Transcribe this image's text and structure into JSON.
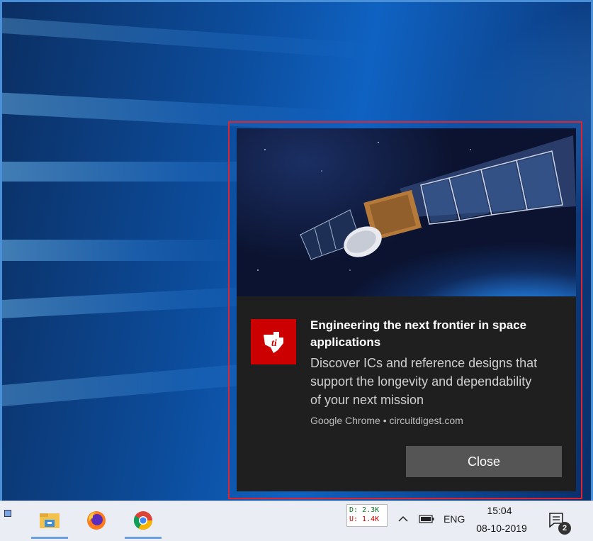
{
  "notification": {
    "title": "Engineering the next frontier in space applications",
    "body": "Discover ICs and reference designs that support the longevity and dependability of your next mission",
    "source": "Google Chrome • circuitdigest.com",
    "close_label": "Close",
    "hero_image_icon": "satellite-image",
    "brand_icon": "texas-instruments-logo-icon",
    "brand_color": "#cc0000"
  },
  "taskbar": {
    "apps": [
      {
        "name": "File Explorer",
        "icon": "folder-icon"
      },
      {
        "name": "Firefox",
        "icon": "firefox-icon"
      },
      {
        "name": "Google Chrome",
        "icon": "chrome-icon"
      }
    ],
    "net_meter": {
      "download": "D: 2.3K",
      "upload": "U: 1.4K"
    },
    "tray": {
      "chevron_icon": "chevron-up-icon",
      "battery_icon": "battery-icon",
      "language": "ENG"
    },
    "clock": {
      "time": "15:04",
      "date": "08-10-2019"
    },
    "action_center": {
      "icon": "action-center-icon",
      "badge": "2"
    }
  },
  "colors": {
    "highlight_border": "#e0232e",
    "toast_background": "#1f1f1f",
    "close_button": "#555555",
    "frame_border": "#4a90d9"
  }
}
